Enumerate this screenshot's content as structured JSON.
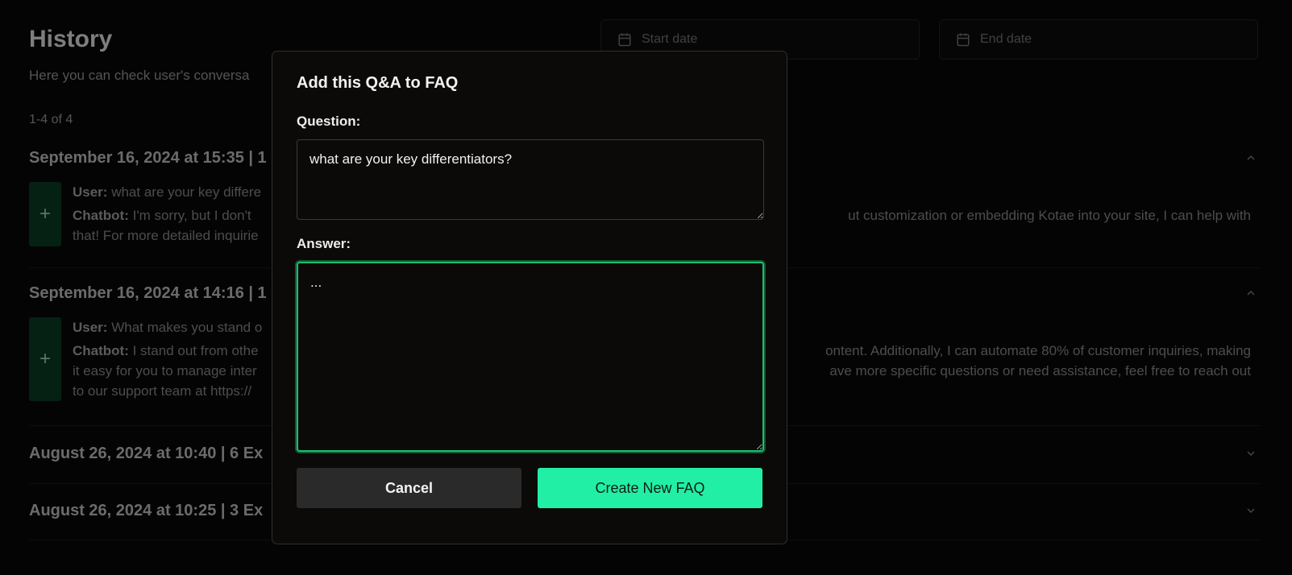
{
  "header": {
    "title": "History",
    "subtitle": "Here you can check user's conversa",
    "count": "1-4 of 4"
  },
  "filters": {
    "start_placeholder": "Start date",
    "end_placeholder": "End date"
  },
  "conversations": [
    {
      "title": "September 16, 2024 at 15:35 | 1",
      "expanded": true,
      "user_label": "User:",
      "user_text": "what are your key differe",
      "bot_label": "Chatbot:",
      "bot_text_left": "I'm sorry, but I don't",
      "bot_text_right": "ut customization or embedding Kotae into your site, I can help with",
      "bot_text_line2": "that! For more detailed inquirie"
    },
    {
      "title": "September 16, 2024 at 14:16 | 1",
      "expanded": true,
      "user_label": "User:",
      "user_text": "What makes you stand o",
      "bot_label": "Chatbot:",
      "bot_text_left": "I stand out from othe",
      "bot_text_right": "ontent. Additionally, I can automate 80% of customer inquiries, making",
      "bot_text_line2_left": "it easy for you to manage inter",
      "bot_text_line2_right": "ave more specific questions or need assistance, feel free to reach out",
      "bot_text_line3": "to our support team at https://"
    },
    {
      "title": "August 26, 2024 at 10:40 | 6 Ex",
      "expanded": false
    },
    {
      "title": "August 26, 2024 at 10:25 | 3 Ex",
      "expanded": false
    }
  ],
  "add_button_label": "+",
  "modal": {
    "title": "Add this Q&A to FAQ",
    "question_label": "Question:",
    "question_value": "what are your key differentiators?",
    "answer_label": "Answer:",
    "answer_value": "...",
    "cancel_label": "Cancel",
    "create_label": "Create New FAQ"
  },
  "colors": {
    "accent": "#22efa6",
    "focus_ring": "#1fbd6e",
    "add_button_bg": "#0a3d24"
  }
}
